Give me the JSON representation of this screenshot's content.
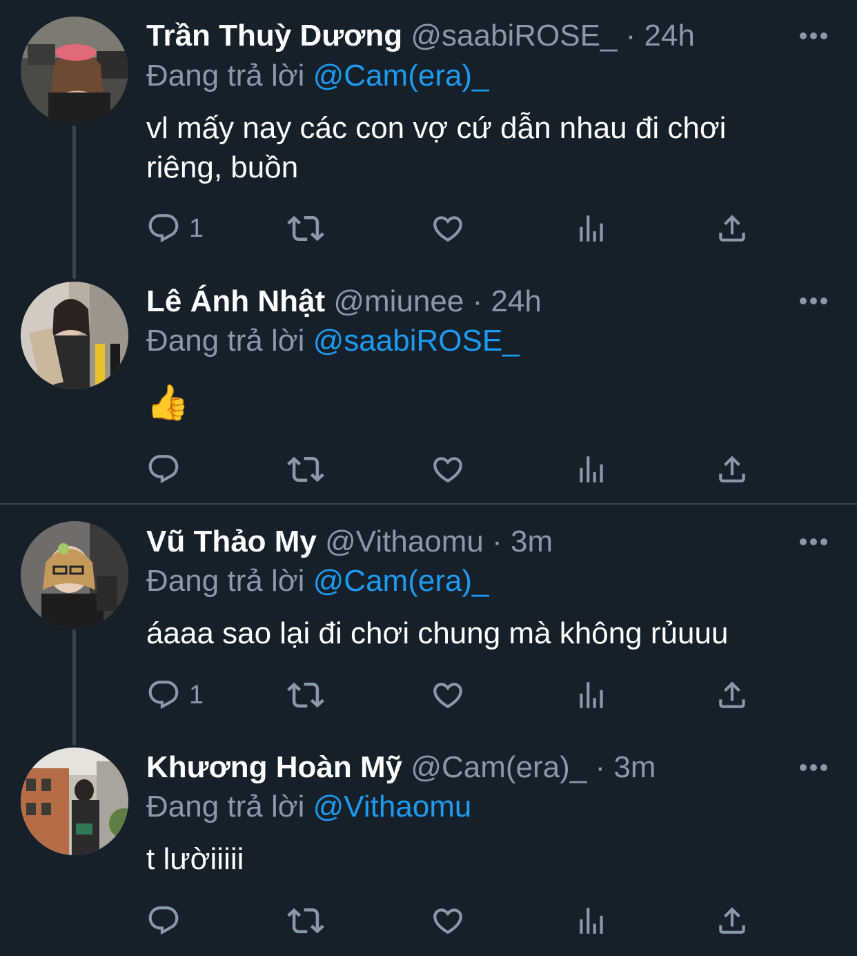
{
  "reply_prefix": "Đang trả lời",
  "tweets": [
    {
      "name": "Trần Thuỳ Dương",
      "handle": "@saabiROSE_",
      "sep": "·",
      "time": "24h",
      "reply_to": "@Cam(era)_",
      "text_lines": [
        "vl mấy nay các con vợ cứ dẫn nhau đi chơi",
        "riêng, buồn"
      ],
      "reply_count": "1"
    },
    {
      "name": "Lê Ánh Nhật",
      "handle": "@miunee",
      "sep": "·",
      "time": "24h",
      "reply_to": "@saabiROSE_",
      "text": "👍",
      "reply_count": ""
    },
    {
      "name": "Vũ Thảo My",
      "handle": "@Vithaomu",
      "sep": "·",
      "time": "3m",
      "reply_to": "@Cam(era)_",
      "text": "áaaa sao lại đi chơi chung mà không rủuuu",
      "reply_count": "1"
    },
    {
      "name": "Khương Hoàn Mỹ",
      "handle": "@Cam(era)_",
      "sep": "·",
      "time": "3m",
      "reply_to": "@Vithaomu",
      "text": "t lườiiiii",
      "reply_count": ""
    }
  ],
  "icons": [
    "reply-icon",
    "retweet-icon",
    "like-icon",
    "analytics-icon",
    "share-icon",
    "more-icon"
  ],
  "colors": {
    "background": "#15202b",
    "secondary_text": "#8b98a5",
    "mention": "#1d9bf0",
    "divider": "#38444d"
  }
}
